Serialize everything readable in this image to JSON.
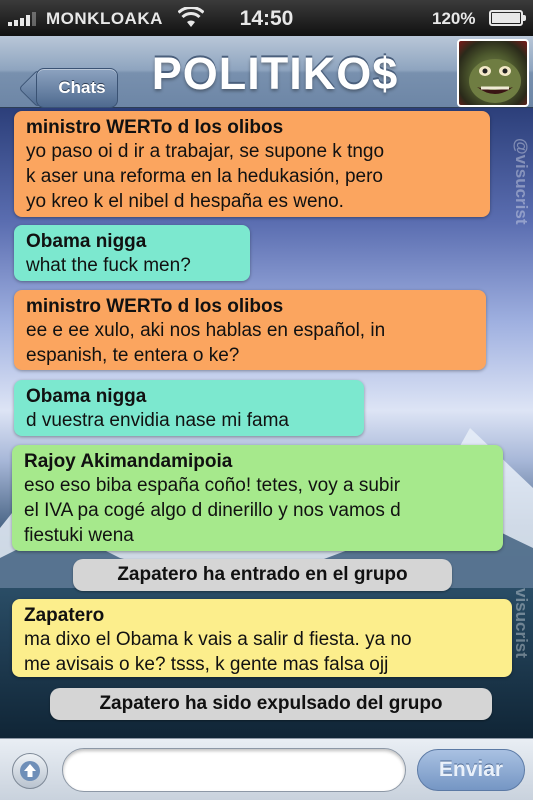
{
  "status_bar": {
    "carrier": "MONKLOAKA",
    "time": "14:50",
    "battery": "120%",
    "signal_icon": "signal-bars-icon",
    "wifi_icon": "wifi-icon",
    "battery_icon": "battery-icon"
  },
  "nav": {
    "back_label": "Chats",
    "title": "POLITIKO$",
    "avatar_icon": "group-avatar"
  },
  "messages": [
    {
      "sender": "ministro WERTo d los olibos",
      "text": "yo paso oi d ir a trabajar, se supone k tngo\nk aser una reforma en la hedukasión, pero\nyo kreo k el nibel d hespaña es weno.",
      "color": "#fba55f"
    },
    {
      "sender": "Obama nigga",
      "text": " what the fuck men?",
      "color": "#7ce8cf"
    },
    {
      "sender": "ministro WERTo d los olibos",
      "text": "ee e ee xulo, aki nos hablas en español, in\nespanish, te entera o ke?",
      "color": "#fba55f"
    },
    {
      "sender": "Obama nigga",
      "text": " d vuestra envidia nase mi fama",
      "color": "#7ce8cf"
    },
    {
      "sender": "Rajoy Akimandamipoia",
      "text": "eso eso biba españa coño! tetes, voy a subir\nel IVA pa cogé algo d dinerillo y nos vamos d\nfiestuki wena",
      "color": "#a6e98c"
    },
    {
      "sender": "Zapatero",
      "text": "ma dixo el Obama k vais a salir d fiesta. ya no\nme avisais o ke? tsss, k gente mas falsa ojj",
      "color": "#fcee8c"
    }
  ],
  "system_messages": [
    "Zapatero ha entrado en el grupo",
    "Zapatero ha sido expulsado del grupo"
  ],
  "watermarks": [
    "@visucrist",
    "visucrist"
  ],
  "input": {
    "placeholder": "",
    "send_label": "Enviar",
    "attach_icon": "upload-arrow-icon"
  }
}
